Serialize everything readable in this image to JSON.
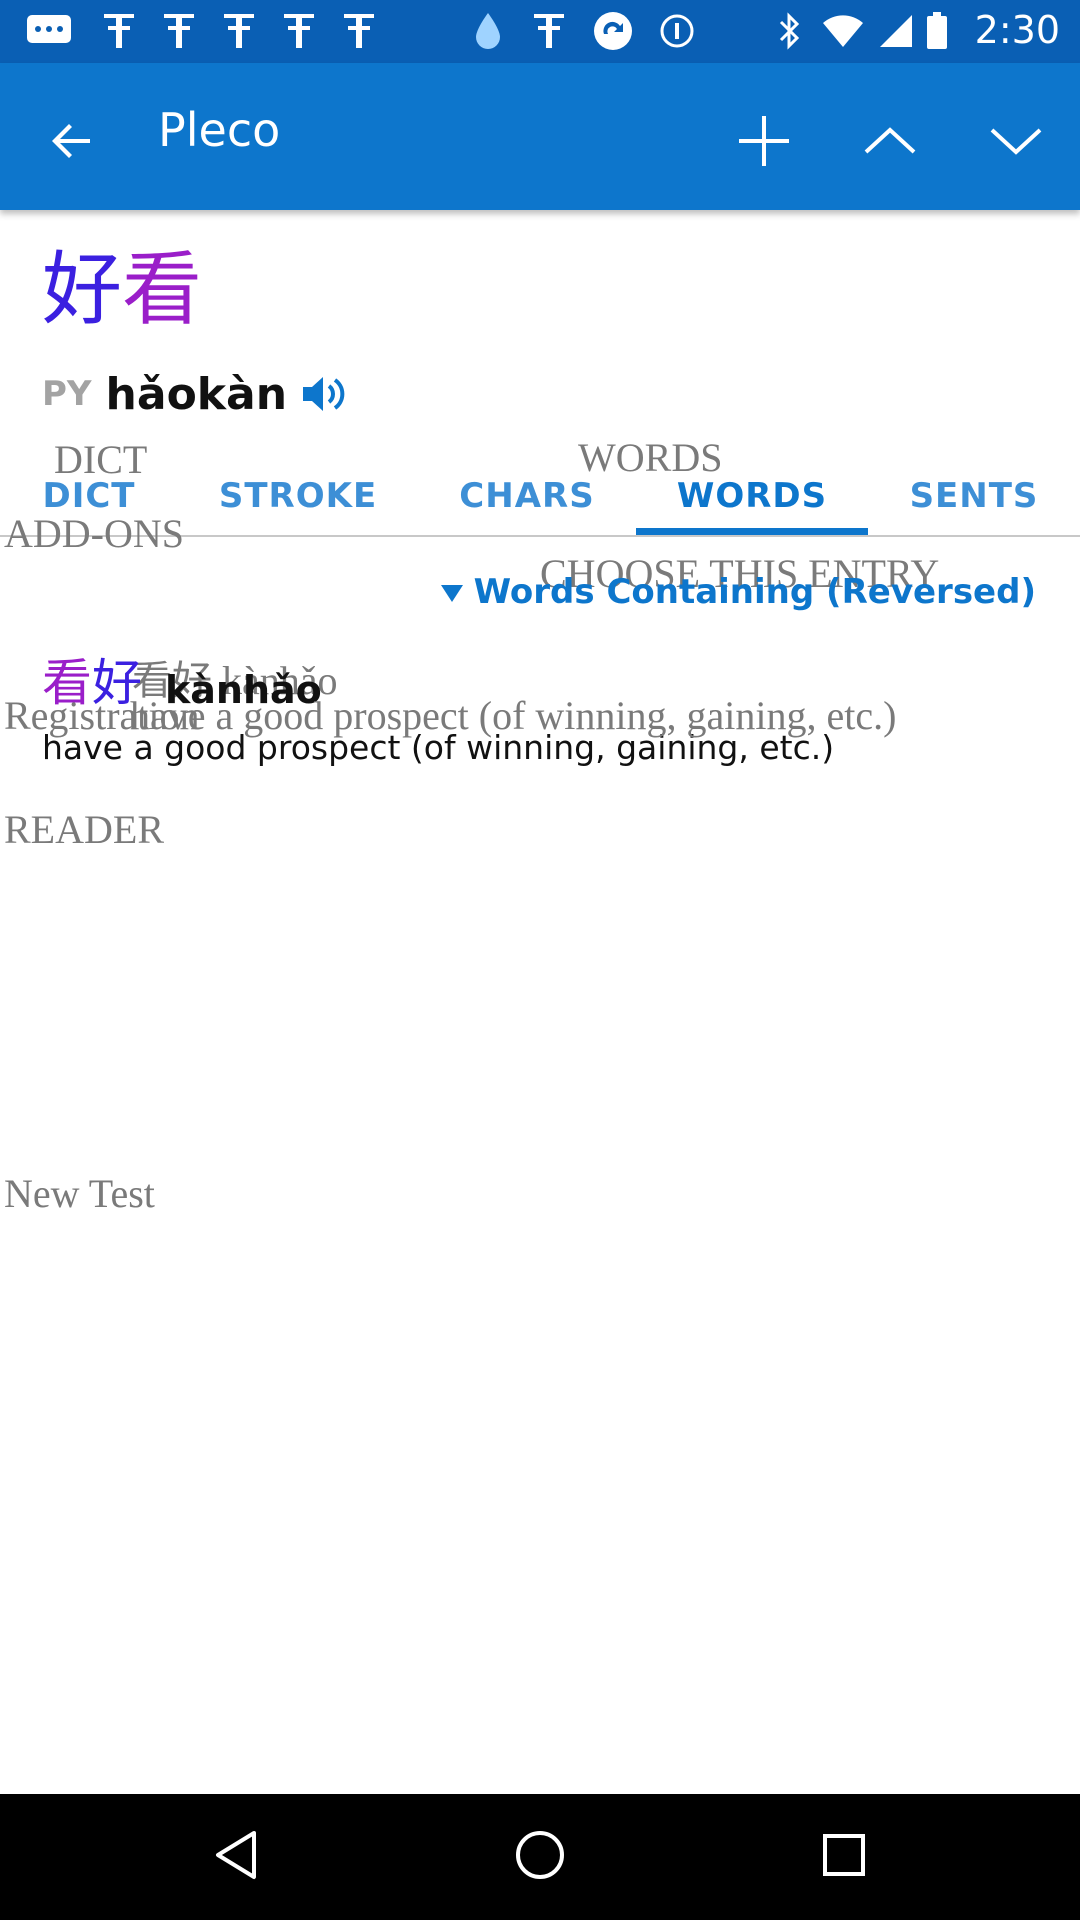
{
  "status_bar": {
    "time": "2:30",
    "icons": [
      "chat-icon",
      "pleco-icon",
      "pleco-icon",
      "pleco-icon",
      "drop-icon",
      "pleco-icon",
      "sync-icon",
      "info-icon",
      "bluetooth-icon",
      "wifi-icon",
      "signal-icon",
      "battery-icon"
    ]
  },
  "app_bar": {
    "title": "Pleco",
    "back_icon": "arrow-back-icon",
    "add_icon": "plus-icon",
    "prev_icon": "chevron-up-icon",
    "next_icon": "chevron-down-icon"
  },
  "headword": {
    "char1": "好",
    "char2": "看",
    "char1_color": "#3b20e0",
    "char2_color": "#9a1ec9",
    "py_label": "PY",
    "pinyin": "hǎokàn",
    "audio_icon": "speaker-icon"
  },
  "tabs": [
    {
      "label": "DICT",
      "active": false
    },
    {
      "label": "STROKE",
      "active": false
    },
    {
      "label": "CHARS",
      "active": false
    },
    {
      "label": "WORDS",
      "active": true
    },
    {
      "label": "SENTS",
      "active": false
    }
  ],
  "section": {
    "title": "Words Containing (Reversed)"
  },
  "entry": {
    "char1": "看",
    "char2": "好",
    "pinyin": "kànhǎo",
    "definition": "have a good prospect (of winning, gaining, etc.)"
  },
  "overlay_text": {
    "dict": "DICT",
    "words": "WORDS",
    "add_ons": "ADD-ONS",
    "choose_entry": "CHOOSE THIS ENTRY",
    "entry_line": "看好 kànhǎo",
    "registration": "Registration",
    "definition": "have a good prospect (of winning, gaining, etc.)",
    "reader": "READER",
    "new_test": "New Test"
  },
  "colors": {
    "status_bar": "#0a5fb4",
    "app_bar": "#0d76cc",
    "accent": "#0d76cc"
  },
  "nav_bar": {
    "back_icon": "nav-back-icon",
    "home_icon": "nav-home-icon",
    "recents_icon": "nav-recents-icon"
  }
}
